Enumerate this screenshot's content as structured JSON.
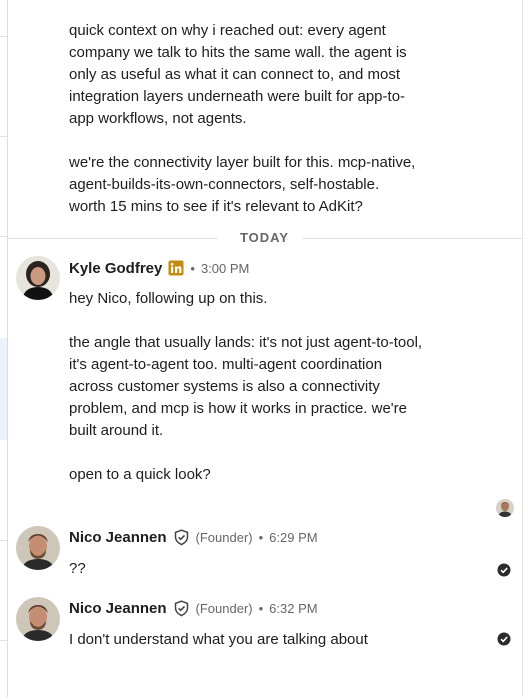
{
  "thread": {
    "earlier_message": {
      "paragraph1": "quick context on why i reached out: every agent\ncompany we talk to hits the same wall. the agent is\nonly as useful as what it can connect to, and most\nintegration layers underneath were built for app-to-\napp workflows, not agents.",
      "paragraph2": "we're the connectivity layer built for this. mcp-native,\nagent-builds-its-own-connectors, self-hostable.\nworth 15 mins to see if it's relevant to AdKit?"
    },
    "date_divider": "TODAY",
    "messages": [
      {
        "sender": "Kyle Godfrey",
        "badge": "linkedin-icon",
        "separator": "•",
        "time": "3:00 PM",
        "p1": "hey Nico, following up on this.",
        "p2": "the angle that usually lands: it's not just agent-to-tool,\nit's agent-to-agent too. multi-agent coordination\nacross customer systems is also a connectivity\nproblem, and mcp is how it works in practice. we're\nbuilt around it.",
        "p3": "open to a quick look?"
      },
      {
        "sender": "Nico Jeannen",
        "badge": "verified-shield-icon",
        "role": "(Founder)",
        "separator": "•",
        "time": "6:29 PM",
        "text": "??"
      },
      {
        "sender": "Nico Jeannen",
        "badge": "verified-shield-icon",
        "role": "(Founder)",
        "separator": "•",
        "time": "6:32 PM",
        "text": "I don't understand what you are talking about"
      }
    ]
  },
  "colors": {
    "linkedin": "#c48a12",
    "text": "#1d1d1d",
    "meta": "#666666",
    "check": "#2b2b2b"
  }
}
